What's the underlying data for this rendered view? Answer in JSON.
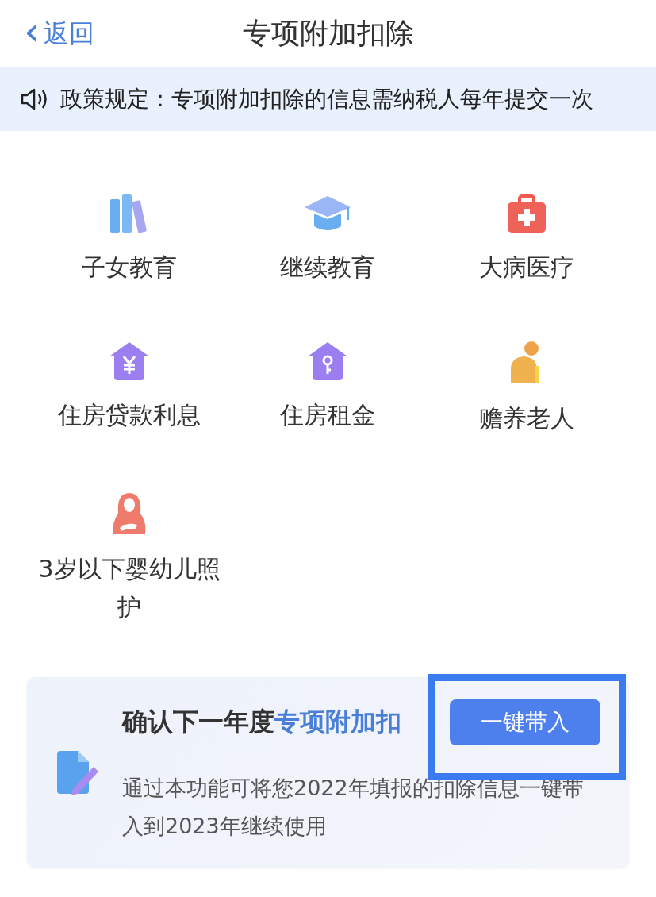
{
  "nav": {
    "back_icon": "‹",
    "back_label": "返回",
    "title": "专项附加扣除"
  },
  "notice": {
    "text": "政策规定：专项附加扣除的信息需纳税人每年提交一次"
  },
  "items": [
    {
      "kind": "books",
      "label": "子女教育"
    },
    {
      "kind": "cap",
      "label": "继续教育"
    },
    {
      "kind": "medkit",
      "label": "大病医疗"
    },
    {
      "kind": "house-yen",
      "label": "住房贷款利息"
    },
    {
      "kind": "house-key",
      "label": "住房租金"
    },
    {
      "kind": "elder",
      "label": "赡养老人"
    },
    {
      "kind": "mother",
      "label": "3岁以下婴幼儿照护"
    }
  ],
  "card": {
    "title": "确认下一年度",
    "title_highlight": "专项附加扣",
    "button": "一键带入",
    "description": "通过本功能可将您2022年填报的扣除信息一键带入到2023年继续使用",
    "highlighted": true
  }
}
